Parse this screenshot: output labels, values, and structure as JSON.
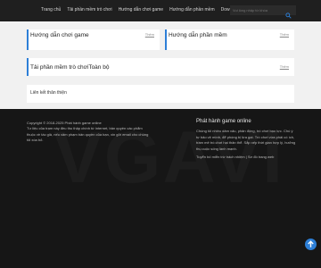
{
  "nav": {
    "items": [
      "Trang chủ",
      "Tải phần mềm trò chơi",
      "Hướng dẫn chơi game",
      "Hướng dẫn phần mềm",
      "Download chủ đề"
    ]
  },
  "search": {
    "placeholder": "Vui lòng nhập từ khóa",
    "icon": "search-icon"
  },
  "sections": {
    "card1": {
      "title": "Hướng dẫn chơi game",
      "more": "Thêm"
    },
    "card2": {
      "title": "Hướng dẫn phần mềm",
      "more": "Thêm"
    },
    "card3": {
      "title": "Tải phần mềm trò chơiToàn bộ",
      "more": "Thêm"
    }
  },
  "links": {
    "title": "Liên kết thân thiện"
  },
  "footer": {
    "copyright": "Copyright © 2018-2025 Phát hành game online",
    "notice": "Tư liệu của trạm này đều thu thập chính từ internet, bản quyền các phẩm thuộc về tác giả, nếu xâm phạm bản quyền của bạn, xin gửi email cho chúng tôi xóa bỏ.",
    "right_title": "Phát hành game online",
    "right_text": "Chúng tôi nhiều dâm vấu, phân động, trò chơi bạo lực. Chú ý tự bảo vệ mình, để phòng bị lừa gạt. Trò chơi vừa phải có ích, trầm mê trò chơi hại thân thể. Sắp xếp thời gian hợp lý, hưởng thụ cuộc sống lành mạnh.",
    "right_links": "Tuyển bố miễn trừ trách nhiệm | Sơ đồ trang web",
    "watermark": "VGAVI"
  },
  "back_to_top": {
    "icon": "arrow-up-icon"
  },
  "colors": {
    "accent": "#2d7fd7",
    "header_bg": "#1f1f1f",
    "footer_bg": "#161616",
    "page_bg": "#f1f1f1"
  }
}
